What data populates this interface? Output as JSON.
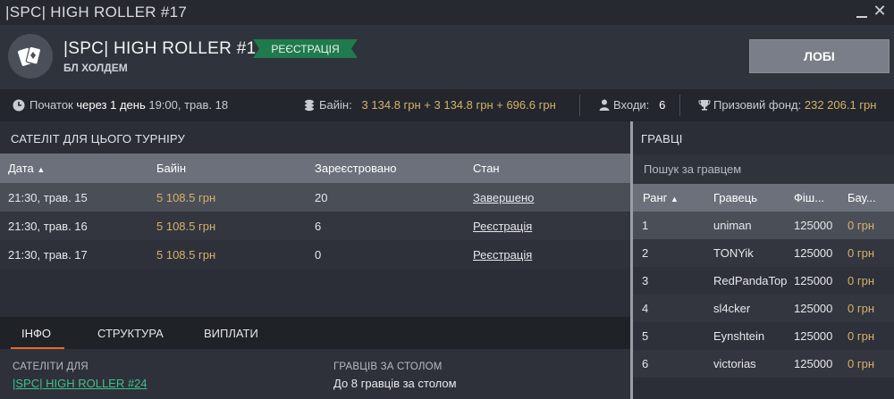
{
  "window": {
    "title": "|SPC| HIGH ROLLER  #17"
  },
  "header": {
    "tournament_name": "|SPC| HIGH ROLLER  #17",
    "game_type": "БЛ ХОЛДЕМ",
    "status_badge": "РЕЄСТРАЦІЯ",
    "lobby_button": "ЛОБІ",
    "colors": {
      "badge": "#1f7a4d",
      "accent_gold": "#d6b26a",
      "tab_accent": "#e86a2a",
      "link_green": "#3fc18c"
    }
  },
  "infobar": {
    "start_label": "Початок",
    "start_relative": "через 1 день",
    "start_time": "19:00, трав. 18",
    "buyin_label": "Байін:",
    "buyin_value": "3 134.8 грн + 3 134.8 грн + 696.6 грн",
    "entries_label": "Входи:",
    "entries_value": "6",
    "prize_label": "Призовий фонд:",
    "prize_value": "232 206.1 грн"
  },
  "satellites": {
    "title": "САТЕЛІТ ДЛЯ ЦЬОГО ТУРНІРУ",
    "columns": [
      "Дата",
      "Байін",
      "Зареєстровано",
      "Стан"
    ],
    "rows": [
      {
        "date": "21:30, трав. 15",
        "buyin": "5 108.5 грн",
        "registered": "20",
        "state": "Завершено"
      },
      {
        "date": "21:30, трав. 16",
        "buyin": "5 108.5 грн",
        "registered": "6",
        "state": "Реєстрація"
      },
      {
        "date": "21:30, трав. 17",
        "buyin": "5 108.5 грн",
        "registered": "0",
        "state": "Реєстрація"
      }
    ]
  },
  "tabs": [
    "ІНФО",
    "СТРУКТУРА",
    "ВИПЛАТИ"
  ],
  "info": {
    "satellites_for_label": "САТЕЛІТИ ДЛЯ",
    "satellites_for_link": "|SPC| HIGH ROLLER  #24",
    "players_per_table_label": "ГРАВЦІВ ЗА СТОЛОМ",
    "players_per_table_value": "До 8 гравців за столом"
  },
  "players": {
    "title": "ГРАВЦІ",
    "search_placeholder": "Пошук за гравцем",
    "columns": [
      "Ранг",
      "Гравець",
      "Фіш...",
      "Бау..."
    ],
    "rows": [
      {
        "rank": "1",
        "name": "uniman",
        "chips": "125000",
        "bounty": "0 грн"
      },
      {
        "rank": "2",
        "name": "TONYik",
        "chips": "125000",
        "bounty": "0 грн"
      },
      {
        "rank": "3",
        "name": "RedPandaTop",
        "chips": "125000",
        "bounty": "0 грн"
      },
      {
        "rank": "4",
        "name": "sl4cker",
        "chips": "125000",
        "bounty": "0 грн"
      },
      {
        "rank": "5",
        "name": "Eynshtein",
        "chips": "125000",
        "bounty": "0 грн"
      },
      {
        "rank": "6",
        "name": "victorias",
        "chips": "125000",
        "bounty": "0 грн"
      }
    ]
  }
}
